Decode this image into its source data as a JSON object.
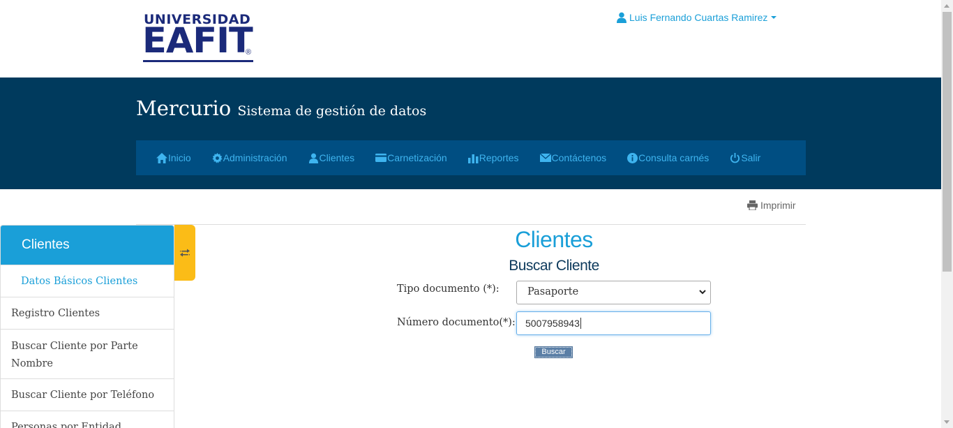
{
  "logo": {
    "line1": "UNIVERSIDAD",
    "line2": "EAFIT",
    "registered": "®"
  },
  "user": {
    "name": "Luis Fernando Cuartas Ramirez",
    "icon": "user-icon"
  },
  "brand": {
    "app": "Mercurio",
    "subtitle": "Sistema de gestión de datos"
  },
  "nav": {
    "items": [
      {
        "label": "Inicio",
        "icon": "home-icon"
      },
      {
        "label": "Administración",
        "icon": "gear-icon"
      },
      {
        "label": "Clientes",
        "icon": "user-icon"
      },
      {
        "label": "Carnetización",
        "icon": "card-icon"
      },
      {
        "label": "Reportes",
        "icon": "bar-chart-icon"
      },
      {
        "label": "Contáctenos",
        "icon": "envelope-icon"
      },
      {
        "label": "Consulta carnés",
        "icon": "info-icon"
      },
      {
        "label": "Salir",
        "icon": "power-icon"
      }
    ]
  },
  "print": {
    "label": "Imprimir",
    "icon": "print-icon"
  },
  "sidebar": {
    "title": "Clientes",
    "items": [
      {
        "label": "Datos Básicos Clientes"
      },
      {
        "label": "Registro Clientes"
      },
      {
        "label": "Buscar Cliente por Parte Nombre"
      },
      {
        "label": "Buscar Cliente por Teléfono"
      },
      {
        "label": "Personas por Entidad"
      }
    ]
  },
  "main": {
    "title": "Clientes",
    "subtitle": "Buscar Cliente",
    "doc_type_label": "Tipo documento (*):",
    "doc_type_value": "Pasaporte",
    "doc_number_label": "Número documento(*):",
    "doc_number_value": "5007958943",
    "search_button": "Buscar"
  },
  "colors": {
    "banner": "#003a5d",
    "nav": "#004e82",
    "accent": "#1a9fd8",
    "toggle": "#fbbc17"
  }
}
